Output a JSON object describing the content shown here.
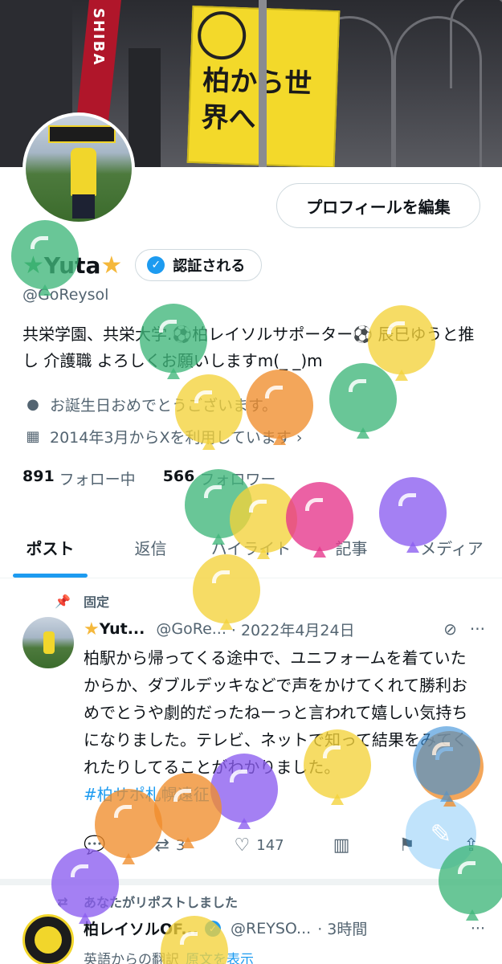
{
  "banner": {
    "sign_text": "SHIBA",
    "flag_text": "柏から世界へ"
  },
  "profile": {
    "edit_button": "プロフィールを編集",
    "name": "Yuta",
    "verified_button": "認証される",
    "handle": "@GoReysol",
    "bio": "共栄学園、共栄大学.⚽柏レイソルサポーター⚽ 辰巳ゆうと推し 介護職 よろしくお願いしますm(_ _)m",
    "birthday": "お誕生日おめでとうございます。",
    "joined": "2014年3月からXを利用しています ›",
    "following_count": "891",
    "following_label": "フォロー中",
    "followers_count": "566",
    "followers_label": "フォロワー"
  },
  "tabs": [
    "ポスト",
    "返信",
    "ハイライト",
    "記事",
    "メディア"
  ],
  "pinned_post": {
    "pinned_label": "固定",
    "author": "Yut...",
    "handle": "@GoRe...",
    "date": "· 2022年4月24日",
    "text": "柏駅から帰ってくる途中で、ユニフォームを着ていたからか、ダブルデッキなどで声をかけてくれて勝利おめでとうや劇的だったねーっと言われて嬉しい気持ちになりました。テレビ、ネットで知って結果をみてくれたりしてることがわかりました。",
    "hashtag": "#柏サポ札幌遠征",
    "reposts": "3",
    "likes": "147"
  },
  "second_post": {
    "repost_label": "あなたがリポストしました",
    "author": "柏レイソルOF...",
    "handle": "@REYSO...",
    "time": "· 3時間",
    "translate_label": "英語からの翻訳",
    "show_original": "原文を表示"
  },
  "icons": {
    "birthday": "balloon-icon",
    "calendar": "calendar-icon",
    "pin": "pin-icon",
    "repost": "repost-icon",
    "reply": "reply-icon",
    "like": "heart-icon",
    "views": "views-icon",
    "bookmark": "bookmark-icon",
    "share": "share-icon",
    "compose": "compose-icon",
    "verified": "verified-badge-icon",
    "grok": "grok-icon",
    "more": "more-icon"
  },
  "colors": {
    "accent": "#1d9bf0",
    "secondary_text": "#536471",
    "star": "#f5b83b"
  }
}
